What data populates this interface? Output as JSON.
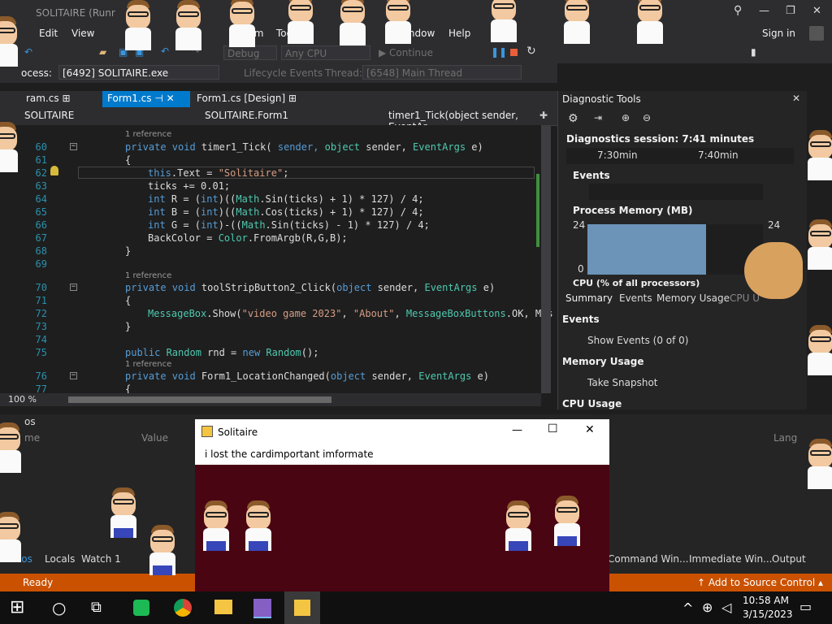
{
  "window": {
    "title": "SOLITAIRE (Runr",
    "signin": "Sign in"
  },
  "menu": {
    "edit": "Edit",
    "view": "View",
    "team": "eam",
    "tools": "Too",
    "window": "Window",
    "help": "Help"
  },
  "toolbar": {
    "config": "Debug",
    "platform": "Any CPU",
    "continue": "Continue"
  },
  "procbar": {
    "label": "ocess:",
    "process": "[6492] SOLITAIRE.exe",
    "lifecycle": "Lifecycle Events",
    "thread_label": "Thread:",
    "thread": "[6548] Main Thread"
  },
  "tabs": [
    {
      "label": "ram.cs"
    },
    {
      "label": "Form1.cs"
    },
    {
      "label": "Form1.cs [Design]"
    }
  ],
  "navbar": {
    "project": "SOLITAIRE",
    "class": "SOLITAIRE.Form1",
    "member": "timer1_Tick(object sender, EventAr"
  },
  "code": {
    "ref": "1 reference",
    "line_numbers": [
      "60",
      "61",
      "62",
      "63",
      "64",
      "65",
      "66",
      "67",
      "68",
      "69",
      "70",
      "71",
      "72",
      "73",
      "74",
      "75",
      "76",
      "77"
    ],
    "l60a": "private void ",
    "l60b": "timer1_Tick(",
    "l60c": "object",
    " l60d": " sender, ",
    "l60e": "EventArgs",
    " l60f": " e)",
    "open": "{",
    "close": "}",
    "l62a": "this",
    ".l62b": ".Text = ",
    "l62c": "\"Solitaire\"",
    "l62d": ";",
    "l63": "ticks += 0.01;",
    "l64a": "int",
    " l64b": " R = (",
    "l64c": "int",
    ")l64d": ")((",
    "l64e": "Math",
    ".l64f": ".Sin(ticks) + 1) * 127) / 4;",
    "l65a": "int",
    " l65b": " B = (",
    "l65c": "int",
    ")l65d": ")((",
    "l65e": "Math",
    ".l65f": ".Cos(ticks) + 1) * 127) / 4;",
    "l66a": "int",
    " l66b": " G = (",
    "l66c": "int",
    ")l66d": ")-((",
    "l66e": "Math",
    ".l66f": ".Sin(ticks) - 1) * 127) / 4;",
    "l67a": "BackColor = ",
    "l67b": "Color",
    ".l67c": ".FromArgb(R,G,B);",
    "l70a": "private void ",
    "l70b": "toolStripButton2_Click(",
    "l70c": "object",
    " l70d": " sender, ",
    "l70e": "EventArgs",
    " l70f": " e)",
    "l72a": "MessageBox",
    ".l72b": ".Show(",
    "l72c": "\"video game 2023\"",
    ", l72d": ", ",
    "l72e": "\"About\"",
    ", l72f": ", ",
    "l72g": "MessageBoxButtons",
    ".l72h": ".OK, Mes",
    "l75a": "public ",
    "l75b": "Random",
    " l75c": " rnd = ",
    "l75d": "new ",
    "l75e": "Random",
    "()l75f": "();",
    "l76a": "private void ",
    "l76b": "Form1_LocationChanged(",
    "l76c": "object",
    " l76d": " sender, ",
    "l76e": "EventArgs",
    " l76f": " e)"
  },
  "zoom": "100 %",
  "diag": {
    "title": "Diagnostic Tools",
    "session": "Diagnostics session: 7:41 minutes",
    "t1": "7:30min",
    "t2": "7:40min",
    "events": "Events",
    "memory": "Process Memory (MB)",
    "mem_max": "24",
    "mem_min": "0",
    "mem_right": "24",
    "cpu": "CPU (% of all processors)",
    "tabs": [
      "Summary",
      "Events",
      "Memory Usage",
      "CPU U"
    ],
    "sec_events": "Events",
    "show_events": "Show Events (0 of 0)",
    "sec_memory": "Memory Usage",
    "snapshot": "Take Snapshot",
    "sec_cpu": "CPU Usage"
  },
  "bottom": {
    "left_title": "os",
    "col_name": "me",
    "col_value": "Value",
    "col_lang": "Lang",
    "tabs_left": [
      "utos",
      "Locals",
      "Watch 1"
    ],
    "tabs_right": [
      "Command Win...",
      "Immediate Win...",
      "Output"
    ]
  },
  "status": {
    "ready": "Ready",
    "source": "Add to Source Control"
  },
  "solitaire": {
    "title": "Solitaire",
    "menu1": "i lost the card",
    "menu2": "important imformate"
  },
  "taskbar": {
    "time": "10:58 AM",
    "date": "3/15/2023"
  },
  "colors": {
    "accent": "#007acc",
    "status": "#ca5100",
    "form_bg": "#4a0512"
  }
}
